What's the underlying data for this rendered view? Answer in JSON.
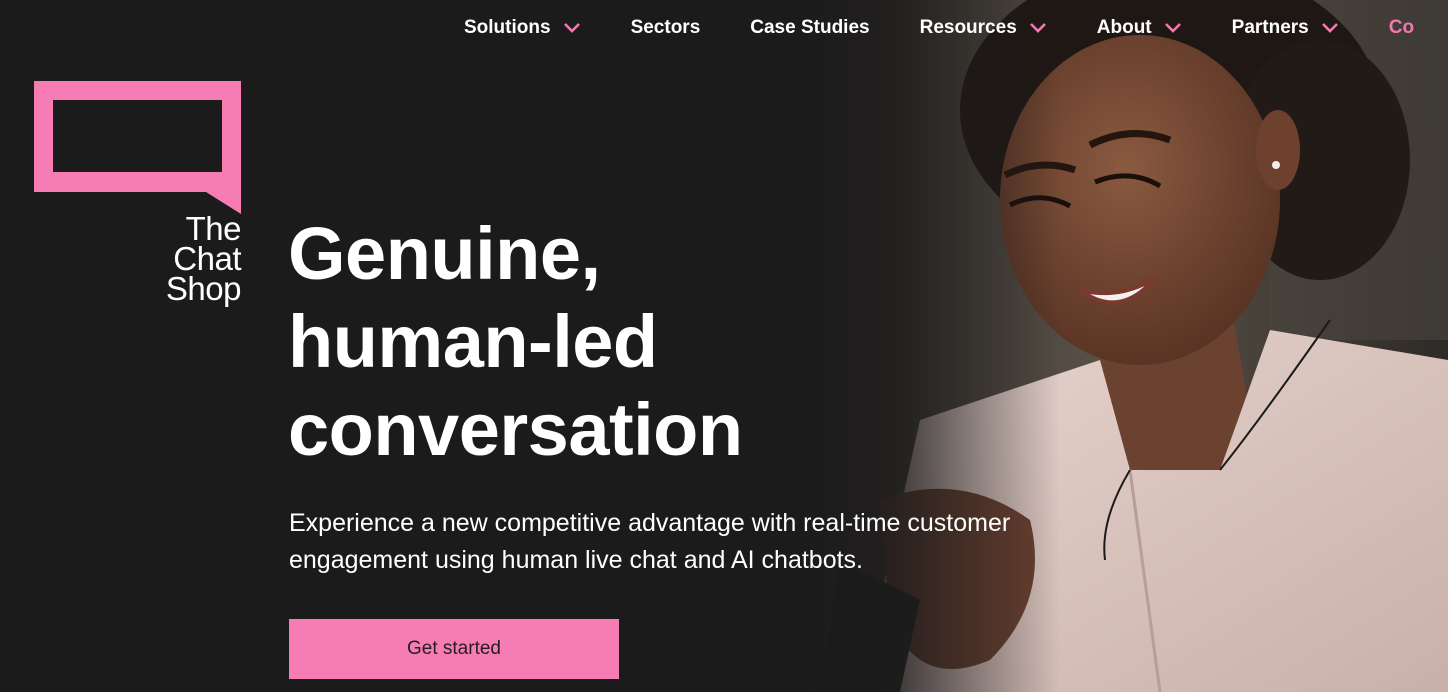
{
  "nav": {
    "items": [
      {
        "label": "Solutions",
        "has_dropdown": true
      },
      {
        "label": "Sectors",
        "has_dropdown": false
      },
      {
        "label": "Case Studies",
        "has_dropdown": false
      },
      {
        "label": "Resources",
        "has_dropdown": true
      },
      {
        "label": "About",
        "has_dropdown": true
      },
      {
        "label": "Partners",
        "has_dropdown": true
      },
      {
        "label": "Co",
        "has_dropdown": false
      }
    ]
  },
  "logo": {
    "line1": "The",
    "line2": "Chat",
    "line3": "Shop"
  },
  "hero": {
    "headline_line1": "Genuine,",
    "headline_line2": "human-led",
    "headline_line3": "conversation",
    "subtext": "Experience a new competitive advantage with real-time customer engagement using human live chat and AI chatbots.",
    "cta_label": "Get started"
  },
  "colors": {
    "background": "#1c1b1b",
    "accent": "#f57db4",
    "text": "#ffffff"
  }
}
